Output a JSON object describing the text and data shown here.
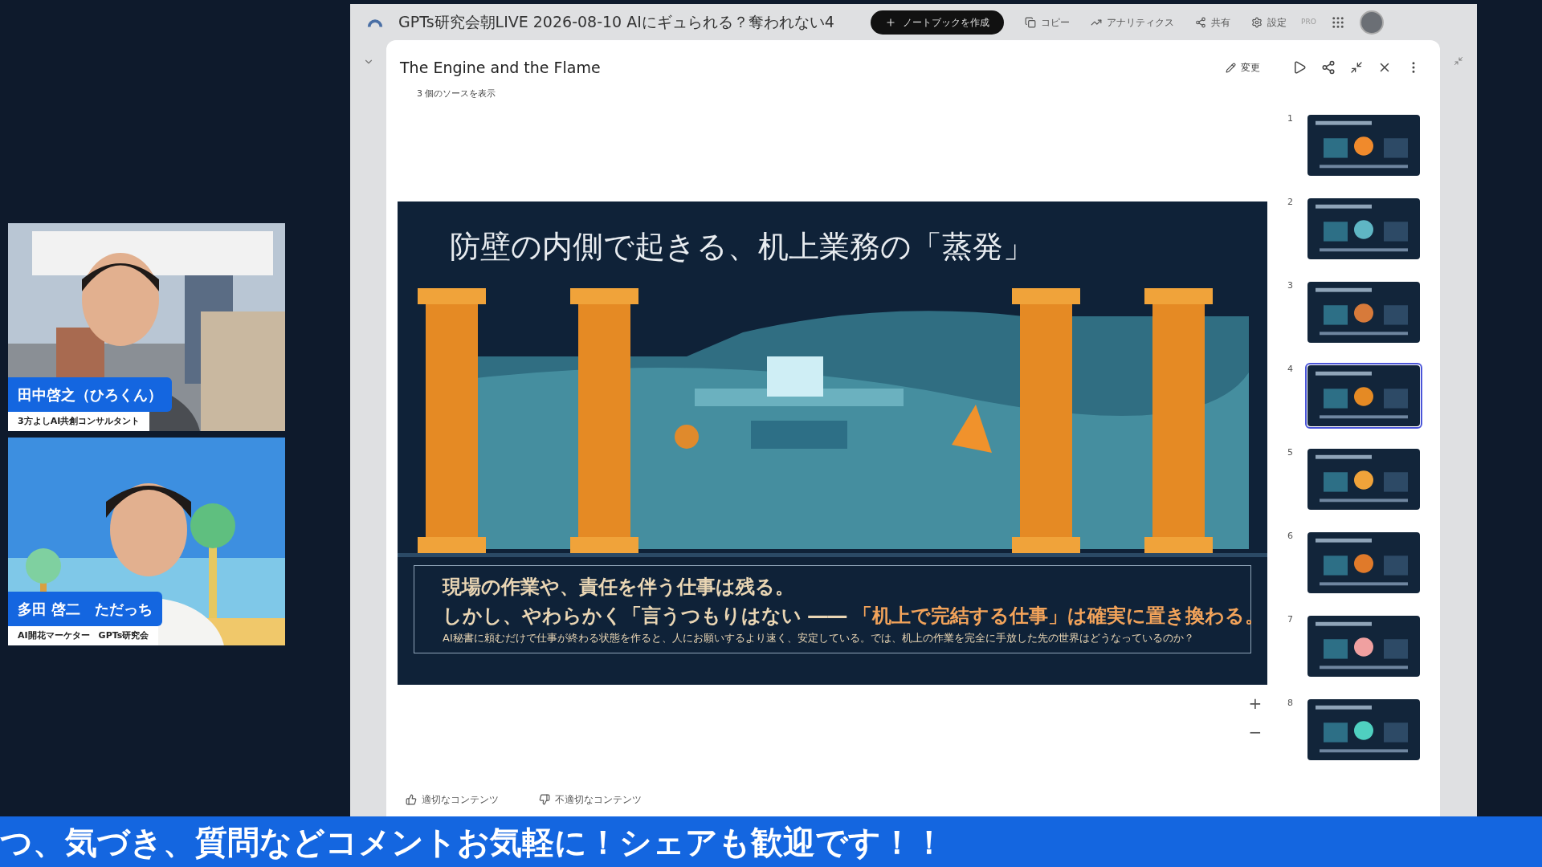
{
  "share": {
    "top_bar": {
      "title": "GPTs研究会朝LIVE 2026-08-10 AIにギュられる？奪われない4",
      "create_button": "ノートブックを作成",
      "actions": [
        "コピー",
        "アナリティクス",
        "共有",
        "設定"
      ],
      "badge": "PRO"
    },
    "viewer": {
      "title": "The Engine and the Flame",
      "sources_link": "3 個のソースを表示",
      "edit_button": "変更",
      "slide": {
        "title": "防壁の内側で起きる、机上業務の「蒸発」",
        "caption_line_1": "現場の作業や、責任を伴う仕事は残る。",
        "caption_line_2": "しかし、やわらかく「言うつもりはない ――",
        "caption_line_2_emphasis": "「机上で完結する仕事」は確実に置き換わる。",
        "caption_line_3": "AI秘書に頼むだけで仕事が終わる状態を作ると、人にお願いするより速く、安定している。では、机上の作業を完全に手放した先の世界はどうなっているのか？"
      },
      "zoom_buttons": [
        "+",
        "−"
      ],
      "thumbnails": [
        {
          "number": "1",
          "selected": false
        },
        {
          "number": "2",
          "selected": false
        },
        {
          "number": "3",
          "selected": false
        },
        {
          "number": "4",
          "selected": true
        },
        {
          "number": "5",
          "selected": false
        },
        {
          "number": "6",
          "selected": false
        },
        {
          "number": "7",
          "selected": false
        },
        {
          "number": "8",
          "selected": false
        }
      ],
      "feedback": [
        "適切なコンテンツ",
        "不適切なコンテンツ"
      ]
    }
  },
  "speakers": [
    {
      "name": "田中啓之（ひろくん）",
      "role": "3方よしAI共創コンサルタント"
    },
    {
      "name": "多田 啓二　ただっち",
      "role": "AI開花マーケター　GPTs研究会"
    }
  ],
  "banner": "つ、気づき、質問などコメントお気軽に！シェアも歓迎です！！"
}
